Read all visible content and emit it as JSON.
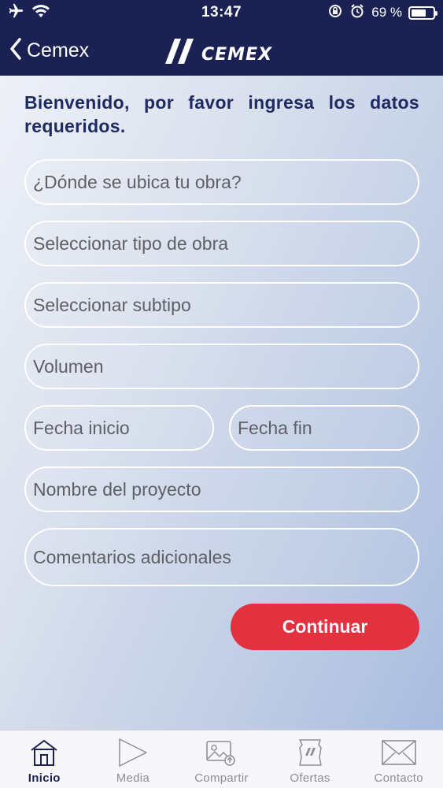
{
  "status_bar": {
    "time": "13:47",
    "battery_text": "69 %",
    "battery_level": 0.69,
    "icons": [
      "airplane-icon",
      "wifi-icon",
      "rotation-lock-icon",
      "alarm-icon",
      "battery-icon"
    ]
  },
  "nav": {
    "back_label": "Cemex",
    "logo_text": "CEMEX"
  },
  "intro": "Bienvenido, por favor ingresa los datos requeridos.",
  "form": {
    "location_placeholder": "¿Dónde se ubica tu obra?",
    "work_type_placeholder": "Seleccionar tipo de obra",
    "subtype_placeholder": "Seleccionar subtipo",
    "volume_placeholder": "Volumen",
    "start_date_placeholder": "Fecha inicio",
    "end_date_placeholder": "Fecha fin",
    "project_name_placeholder": "Nombre del proyecto",
    "comments_placeholder": "Comentarios adicionales",
    "submit_label": "Continuar"
  },
  "tabs": [
    {
      "label": "Inicio",
      "icon": "home-icon",
      "active": true
    },
    {
      "label": "Media",
      "icon": "play-icon",
      "active": false
    },
    {
      "label": "Compartir",
      "icon": "image-upload-icon",
      "active": false
    },
    {
      "label": "Ofertas",
      "icon": "cemex-bag-icon",
      "active": false
    },
    {
      "label": "Contacto",
      "icon": "envelope-icon",
      "active": false
    }
  ],
  "colors": {
    "header": "#1b2253",
    "accent": "#e3323f",
    "heading_text": "#1e2a62"
  }
}
